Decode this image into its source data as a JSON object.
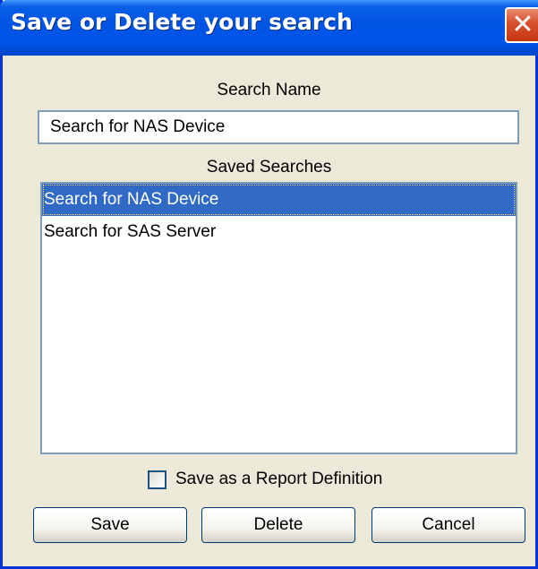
{
  "dialog": {
    "title": "Save or Delete your search",
    "close_glyph": "✕",
    "search_name_label": "Search Name",
    "search_name_value": "Search for NAS Device",
    "saved_searches_label": "Saved Searches",
    "saved_searches": [
      {
        "label": "Search for NAS Device",
        "selected": true
      },
      {
        "label": "Search for SAS Server",
        "selected": false
      }
    ],
    "report_checkbox": {
      "label": "Save as a Report Definition",
      "checked": false
    },
    "buttons": {
      "save": "Save",
      "delete": "Delete",
      "cancel": "Cancel"
    }
  },
  "colors": {
    "titlebar": "#0054e3",
    "selection": "#316ac5",
    "dialog_bg": "#ece9d8",
    "close_button": "#d7502e"
  }
}
